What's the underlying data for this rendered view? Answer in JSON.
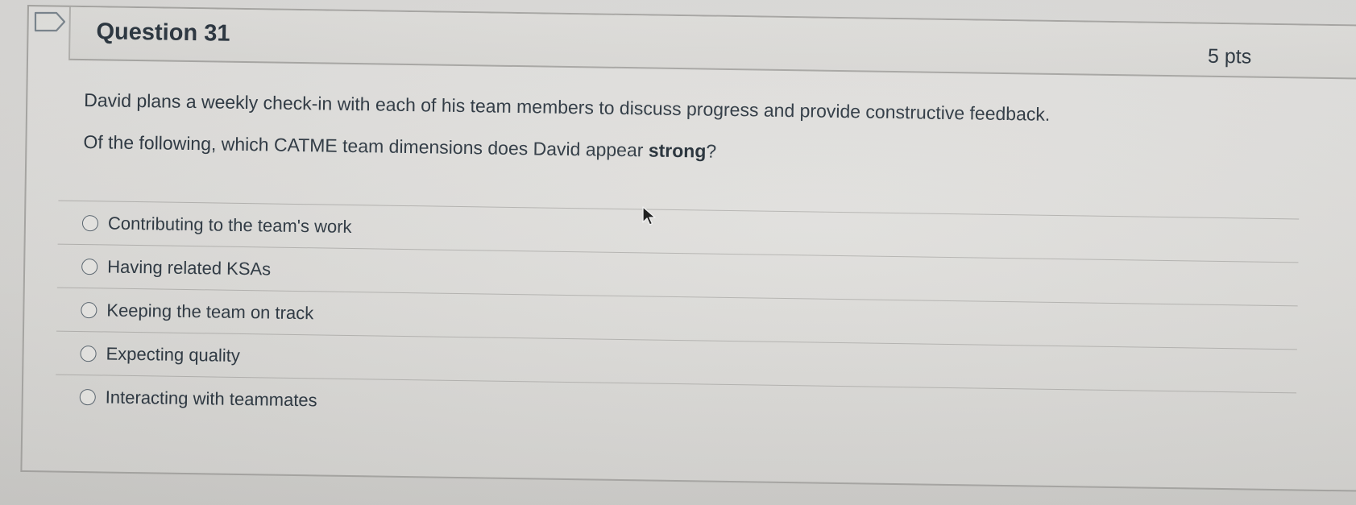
{
  "question": {
    "title": "Question 31",
    "points": "5 pts",
    "prompt": "David plans a weekly check-in with each of his team members to discuss progress and provide constructive feedback.",
    "subprompt_before": "Of the following, which CATME team dimensions does David appear ",
    "subprompt_bold": "strong",
    "subprompt_after": "?"
  },
  "answers": [
    {
      "label": "Contributing to the team's work"
    },
    {
      "label": "Having related KSAs"
    },
    {
      "label": "Keeping the team on track"
    },
    {
      "label": "Expecting quality"
    },
    {
      "label": "Interacting with teammates"
    }
  ],
  "icons": {
    "flag": "flag-question-icon",
    "cursor": "mouse-pointer-icon",
    "radio": "radio-unselected"
  },
  "colors": {
    "text": "#2b3640",
    "border": "#a9a8a5",
    "background": "#dddcd9"
  }
}
